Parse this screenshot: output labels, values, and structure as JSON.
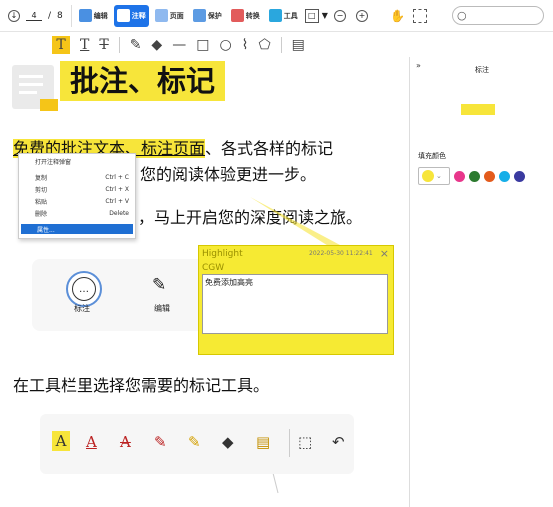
{
  "toolbar": {
    "page_current": "4",
    "page_sep": "/",
    "page_total": "8",
    "tabs": [
      {
        "label": "编辑",
        "icon": "edit-icon"
      },
      {
        "label": "注释",
        "icon": "annotate-icon"
      },
      {
        "label": "页面",
        "icon": "page-icon"
      },
      {
        "label": "保护",
        "icon": "protect-icon"
      },
      {
        "label": "转换",
        "icon": "convert-icon"
      },
      {
        "label": "工具",
        "icon": "tools-icon"
      }
    ],
    "zoom_minus": "−",
    "zoom_plus": "+"
  },
  "right_panel": {
    "expand": "»",
    "title": "标注",
    "fill_label": "填充颜色",
    "colors": [
      "#e8378b",
      "#2c7a2f",
      "#e35b1c",
      "#16aee8",
      "#3a3aa0"
    ],
    "selected_color": "#f7e53a"
  },
  "doc": {
    "heading": "批注、标记",
    "para1_hl": "免费的批注文本、标注页面",
    "para1_rest": "、各式各样的标记",
    "para2": "您的阅读体验更进一步。",
    "para3": "，马上开启您的深度阅读之旅。",
    "annotate_label": "标注",
    "edit_label": "编辑",
    "para4": "在工具栏里选择您需要的标记工具。"
  },
  "context_menu": {
    "items": [
      {
        "label": "打开注释弹窗",
        "shortcut": ""
      },
      {
        "label": "复制",
        "shortcut": "Ctrl + C"
      },
      {
        "label": "剪切",
        "shortcut": "Ctrl + X"
      },
      {
        "label": "粘贴",
        "shortcut": "Ctrl + V"
      },
      {
        "label": "删除",
        "shortcut": "Delete"
      },
      {
        "label": "属性...",
        "shortcut": ""
      }
    ]
  },
  "note": {
    "title": "Highlight",
    "timestamp": "2022-05-30 11:22:41",
    "close": "×",
    "author": "CGW",
    "content": "免费添加高亮"
  }
}
